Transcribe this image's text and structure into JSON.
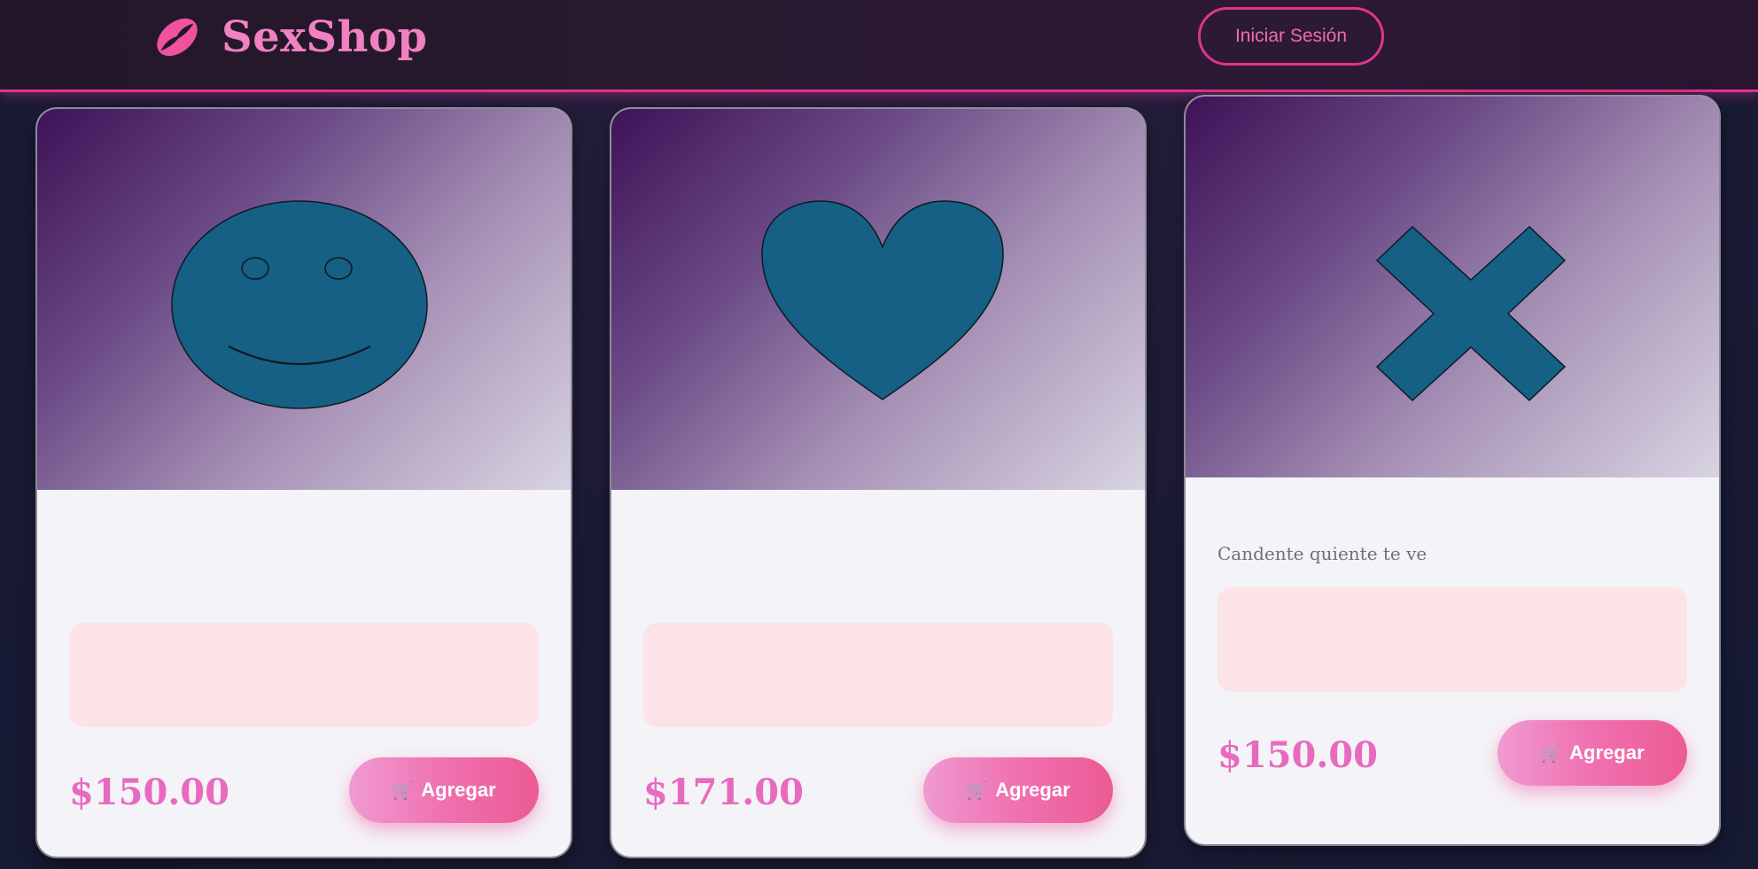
{
  "header": {
    "brand": "SexShop",
    "login_label": "Iniciar Sesión",
    "accent_color": "#e0338f",
    "logo_icon": "lips-icon"
  },
  "products": [
    {
      "image_icon": "smiley-face-icon",
      "title": "",
      "subtitle": "",
      "features": [],
      "price": "$150.00",
      "add_label": "Agregar",
      "cart_icon": "cart-icon"
    },
    {
      "image_icon": "heart-icon",
      "title": "",
      "subtitle": "",
      "features": [],
      "price": "$171.00",
      "add_label": "Agregar",
      "cart_icon": "cart-icon"
    },
    {
      "image_icon": "x-cross-icon",
      "title": "",
      "subtitle": "Candente quiente te ve",
      "features": [],
      "price": "$150.00",
      "add_label": "Agregar",
      "cart_icon": "cart-icon"
    }
  ]
}
